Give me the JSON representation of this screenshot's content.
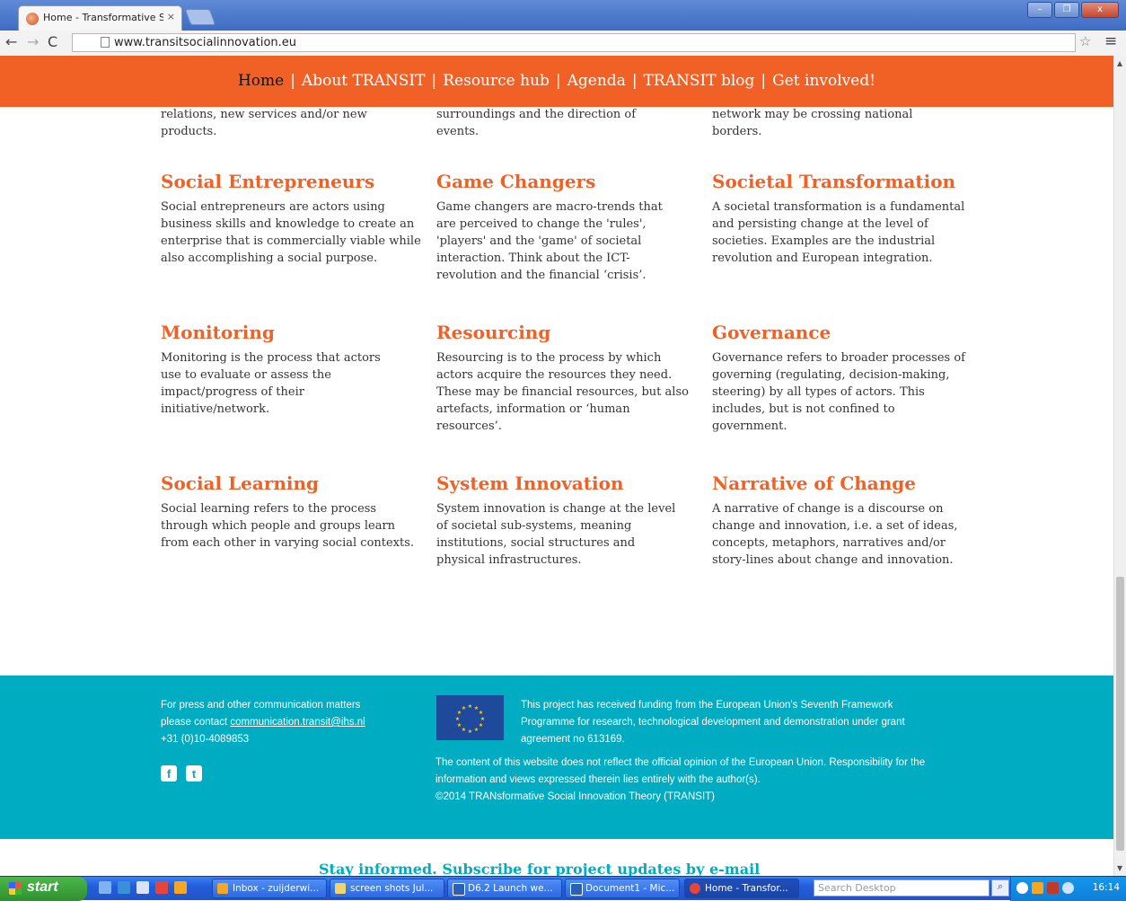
{
  "browser": {
    "tab_title": "Home - Transformative Socia",
    "tab_close": "×",
    "url": "www.transitsocialinnovation.eu",
    "back_glyph": "←",
    "forward_glyph": "→",
    "reload_glyph": "C",
    "star_glyph": "☆",
    "menu_glyph": "≡",
    "minimize_glyph": "–",
    "restore_glyph": "❐",
    "close_glyph": "x"
  },
  "site_nav": {
    "items": [
      "Home",
      "About TRANSIT",
      "Resource hub",
      "Agenda",
      "TRANSIT blog",
      "Get involved!"
    ],
    "separator": "|"
  },
  "top_snippets": {
    "col1": "relations, new services and/or new products.",
    "col2": "surroundings and the direction of events.",
    "col3": "network may be crossing national borders."
  },
  "concepts": [
    {
      "title": "Social Entrepreneurs",
      "text": "Social entrepreneurs are actors using business skills and knowledge to create an enterprise that is commercially viable while also accomplishing a social purpose."
    },
    {
      "title": "Game Changers",
      "text": "Game changers are macro-trends that are perceived to change the 'rules', 'players' and the 'game' of societal interaction. Think about the ICT-revolution and the financial ‘crisis’."
    },
    {
      "title": "Societal Transformation",
      "text": "A societal transformation is a fundamental and persisting change at the level of societies. Examples are the industrial revolution and European integration."
    },
    {
      "title": "Monitoring",
      "text": "Monitoring is the process that actors use to evaluate or assess the impact/progress of their initiative/network."
    },
    {
      "title": "Resourcing",
      "text": "Resourcing is to the process by which actors acquire the resources they need. These may be financial resources, but also artefacts, information or ‘human resources’."
    },
    {
      "title": "Governance",
      "text": "Governance refers to broader processes of governing (regulating, decision-making, steering) by all types of actors. This includes, but is not confined to government."
    },
    {
      "title": "Social Learning",
      "text": "Social learning refers to the process through which people and groups learn from each other in varying social contexts."
    },
    {
      "title": "System Innovation",
      "text": "System innovation is change at the level of societal sub-systems, meaning institutions, social structures and physical infrastructures."
    },
    {
      "title": "Narrative of Change",
      "text": "A narrative of change is a discourse on change and innovation, i.e. a set of ideas, concepts, metaphors, narratives and/or story-lines about change and innovation."
    }
  ],
  "footer": {
    "contact_line1": "For press and other communication matters",
    "contact_prefix": "please contact ",
    "contact_email": "communication.transit@ihs.nl",
    "contact_phone": "+31 (0)10-4089853",
    "facebook_glyph": "f",
    "twitter_glyph": "t",
    "funding": "This project has received funding from the European Union's Seventh Framework Programme for research, technological development and demonstration under grant agreement no 613169.",
    "disclaimer": "The content of this website does not reflect the official opinion of the European Union. Responsibility for the information and views expressed therein lies entirely with the author(s).",
    "copyright": "©2014 TRANsformative Social Innovation Theory (TRANSIT)"
  },
  "subscribe": "Stay informed. Subscribe for project updates by e-mail",
  "taskbar": {
    "start_label": "start",
    "tasks": [
      {
        "label": "Inbox - zuijderwi...",
        "icon_color": "#f5a623"
      },
      {
        "label": "screen shots Jul...",
        "icon_color": "#f3d36b"
      },
      {
        "label": "D6.2 Launch we...",
        "icon_color": "#2b5fb8"
      },
      {
        "label": "Document1 - Mic...",
        "icon_color": "#2b5fb8"
      },
      {
        "label": "Home - Transfor...",
        "icon_color": "#e7453a"
      }
    ],
    "search_placeholder": "Search Desktop",
    "search_glyph": "⌕",
    "clock": "16:14"
  },
  "colors": {
    "brand_orange": "#f16126",
    "footer_teal": "#00acc1"
  }
}
